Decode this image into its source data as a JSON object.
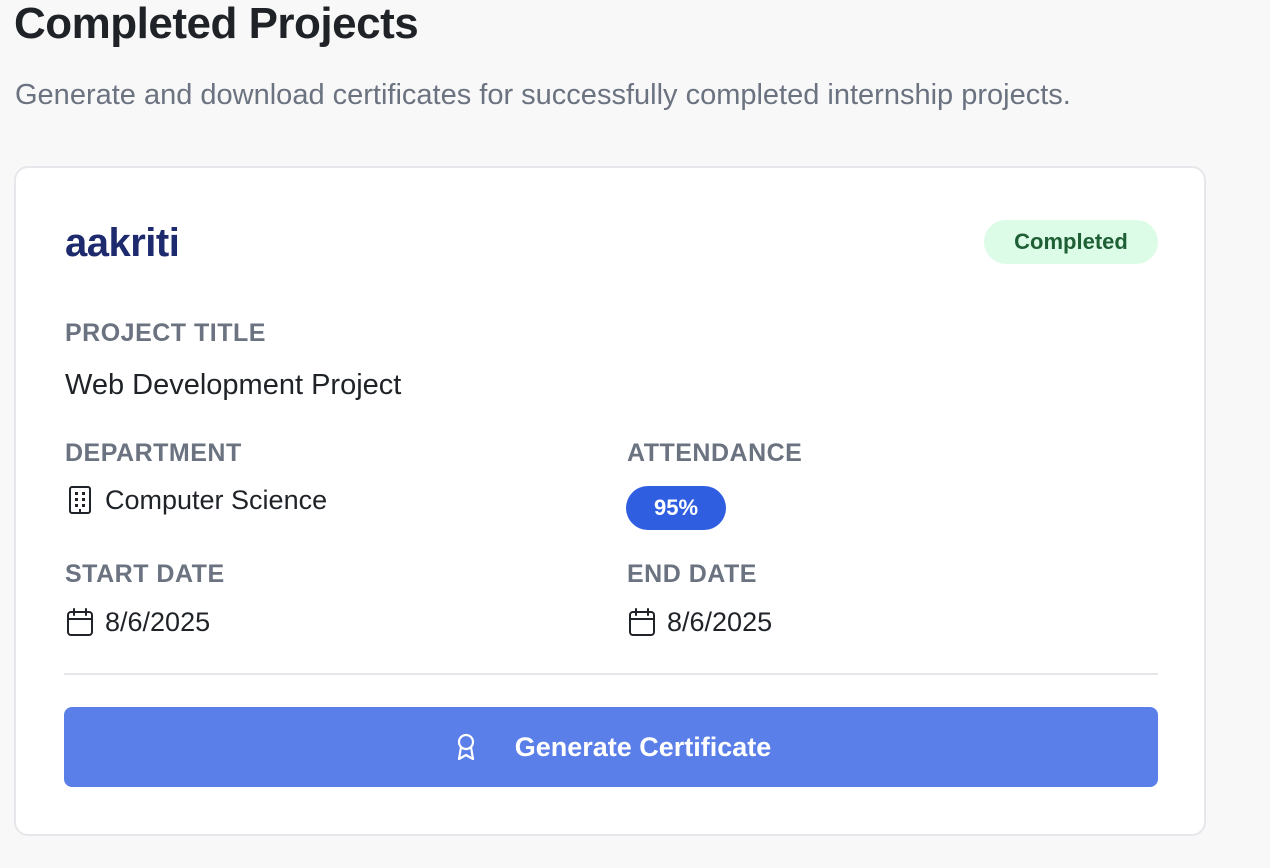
{
  "header": {
    "title": "Completed Projects",
    "subtitle": "Generate and download certificates for successfully completed internship projects."
  },
  "project_card": {
    "intern_name": "aakriti",
    "status": "Completed",
    "project_title_label": "PROJECT TITLE",
    "project_title": "Web Development Project",
    "department_label": "DEPARTMENT",
    "department": "Computer Science",
    "attendance_label": "ATTENDANCE",
    "attendance": "95%",
    "start_date_label": "START DATE",
    "start_date": "8/6/2025",
    "end_date_label": "END DATE",
    "end_date": "8/6/2025",
    "generate_button_label": "Generate Certificate"
  },
  "icons": {
    "department": "building-icon",
    "start_date": "calendar-icon",
    "end_date": "calendar-icon",
    "generate": "award-ribbon-icon"
  },
  "colors": {
    "intern_name": "#1e2a6e",
    "status_badge_bg": "#dcfce7",
    "status_badge_text": "#1f5f35",
    "attendance_pill": "#2f5fe0",
    "primary_button": "#5b7fe8"
  }
}
